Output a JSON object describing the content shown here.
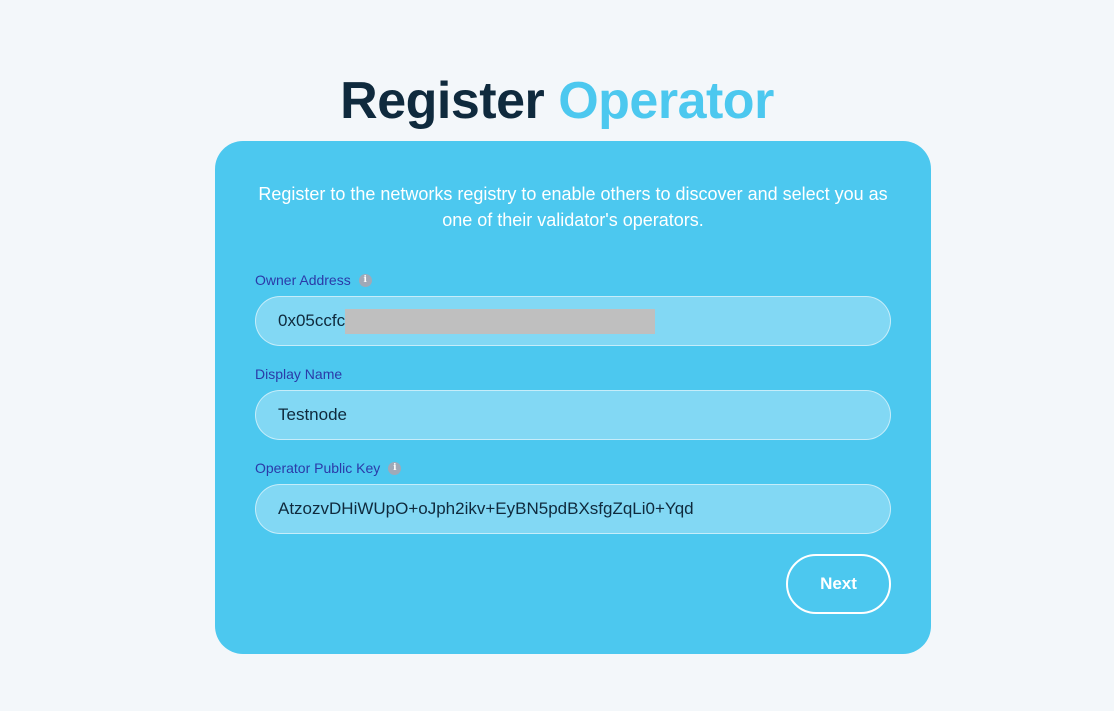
{
  "header": {
    "title_main": "Register",
    "title_accent": "Operator"
  },
  "form": {
    "intro": "Register to the networks registry to enable others to discover and select you as one of their validator's operators.",
    "owner_address": {
      "label": "Owner Address",
      "value": "0x05ccfc",
      "redacted": true
    },
    "display_name": {
      "label": "Display Name",
      "value": "Testnode"
    },
    "operator_public_key": {
      "label": "Operator Public Key",
      "value": "AtzozvDHiWUpO+oJph2ikv+EyBN5pdBXsfgZqLi0+Yqd"
    },
    "next_label": "Next"
  },
  "icons": {
    "info": "info-icon"
  },
  "colors": {
    "accent": "#4cc8ef",
    "title_dark": "#0f2a3d",
    "label": "#2b3aa8",
    "field_bg": "#82d8f4",
    "page_bg": "#f3f7fa"
  }
}
